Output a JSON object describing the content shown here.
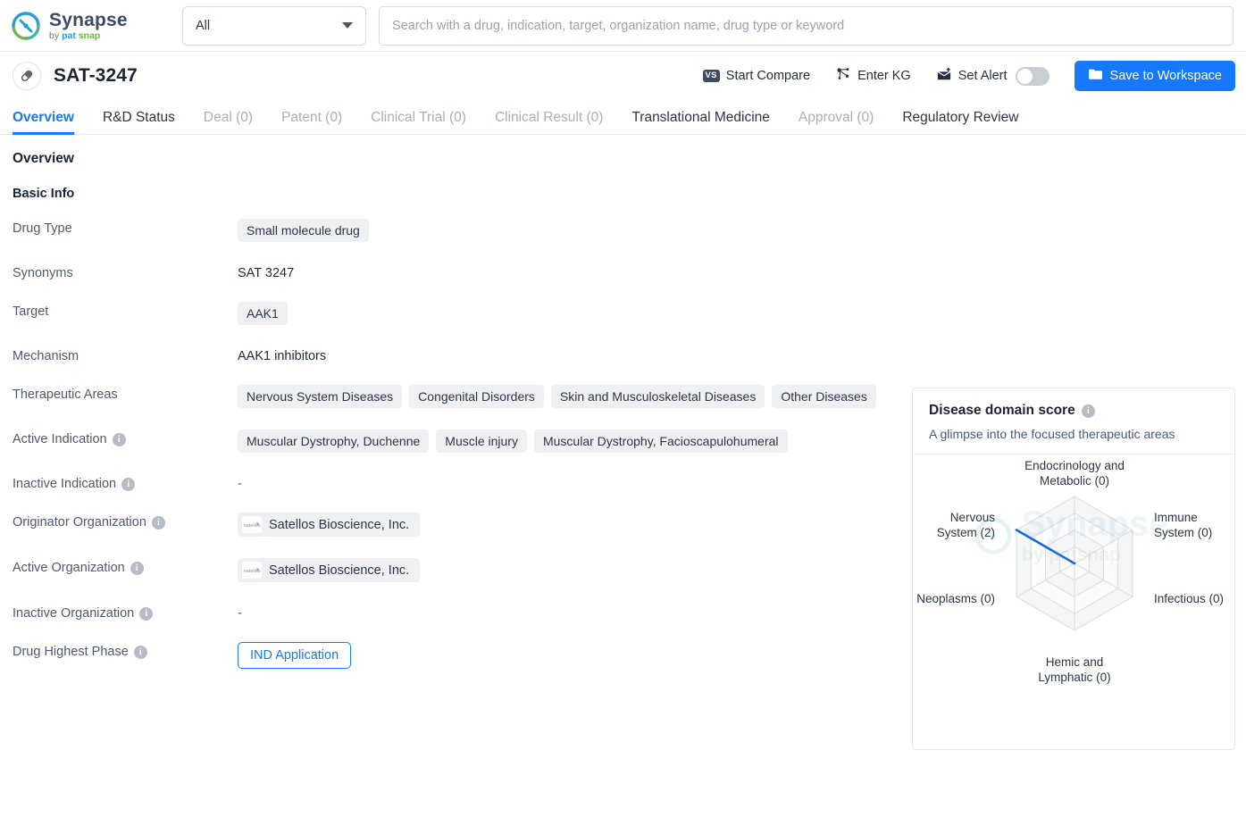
{
  "brand": {
    "name": "Synapse",
    "by": "by",
    "pat": "pat",
    "snap": "snap",
    "logo_icon": "synapse-logo-icon"
  },
  "search": {
    "scope_selected": "All",
    "scope_options": [
      "All"
    ],
    "placeholder": "Search with a drug, indication, target, organization name, drug type or keyword",
    "value": "",
    "dropdown_icon": "chevron-down-icon"
  },
  "drug_header": {
    "icon": "capsule-icon",
    "title": "SAT-3247",
    "actions": {
      "start_compare": "Start Compare",
      "start_compare_icon": "vs-icon",
      "enter_kg": "Enter KG",
      "enter_kg_icon": "knowledge-graph-icon",
      "set_alert": "Set Alert",
      "set_alert_icon": "alert-bell-icon",
      "alert_toggle_state": "off",
      "save_to_workspace": "Save to Workspace",
      "save_icon": "folder-icon"
    }
  },
  "tabs": [
    {
      "label": "Overview",
      "state": "active"
    },
    {
      "label": "R&D Status",
      "state": "enabled"
    },
    {
      "label": "Deal (0)",
      "state": "disabled"
    },
    {
      "label": "Patent (0)",
      "state": "disabled"
    },
    {
      "label": "Clinical Trial (0)",
      "state": "disabled"
    },
    {
      "label": "Clinical Result (0)",
      "state": "disabled"
    },
    {
      "label": "Translational Medicine",
      "state": "enabled"
    },
    {
      "label": "Approval (0)",
      "state": "disabled"
    },
    {
      "label": "Regulatory Review",
      "state": "enabled"
    }
  ],
  "overview": {
    "heading": "Overview",
    "basic_info_heading": "Basic Info",
    "rows": [
      {
        "label": "Drug Type",
        "has_info": false,
        "type": "tags",
        "values": [
          "Small molecule drug"
        ]
      },
      {
        "label": "Synonyms",
        "has_info": false,
        "type": "plain",
        "values": [
          "SAT 3247"
        ]
      },
      {
        "label": "Target",
        "has_info": false,
        "type": "tags",
        "values": [
          "AAK1"
        ]
      },
      {
        "label": "Mechanism",
        "has_info": false,
        "type": "plain",
        "values": [
          "AAK1 inhibitors"
        ]
      },
      {
        "label": "Therapeutic Areas",
        "has_info": false,
        "type": "tags",
        "values": [
          "Nervous System Diseases",
          "Congenital Disorders",
          "Skin and Musculoskeletal Diseases",
          "Other Diseases"
        ]
      },
      {
        "label": "Active Indication",
        "has_info": true,
        "type": "tags",
        "values": [
          "Muscular Dystrophy, Duchenne",
          "Muscle injury",
          "Muscular Dystrophy, Facioscapulohumeral"
        ]
      },
      {
        "label": "Inactive Indication",
        "has_info": true,
        "type": "empty",
        "values": [
          "-"
        ]
      },
      {
        "label": "Originator Organization",
        "has_info": true,
        "type": "org",
        "values": [
          "Satellos Bioscience, Inc."
        ]
      },
      {
        "label": "Active Organization",
        "has_info": true,
        "type": "org",
        "values": [
          "Satellos Bioscience, Inc."
        ]
      },
      {
        "label": "Inactive Organization",
        "has_info": true,
        "type": "empty",
        "values": [
          "-"
        ]
      },
      {
        "label": "Drug Highest Phase",
        "has_info": true,
        "type": "button",
        "values": [
          "IND Application"
        ]
      }
    ]
  },
  "radar_panel": {
    "title": "Disease domain score",
    "has_info": true,
    "subtitle": "A glimpse into the focused therapeutic areas"
  },
  "chart_data": {
    "type": "radar",
    "title": "Disease domain score",
    "subtitle": "A glimpse into the focused therapeutic areas",
    "categories": [
      "Endocrinology and Metabolic (0)",
      "Immune System (0)",
      "Infectious (0)",
      "Hemic and Lymphatic (0)",
      "Neoplasms (0)",
      "Nervous System (2)"
    ],
    "category_names": [
      "Endocrinology and Metabolic",
      "Immune System",
      "Infectious",
      "Hemic and Lymphatic",
      "Neoplasms",
      "Nervous System"
    ],
    "values": [
      0,
      0,
      0,
      0,
      0,
      2
    ],
    "rmax": 2,
    "rings": 4,
    "series_color": "#1668dc",
    "grid_color": "#d9dce1",
    "grid_fill": "#f3f4f6",
    "legend": "none"
  },
  "watermark": {
    "name": "Synapse",
    "sub": "by patsnap"
  },
  "colors": {
    "accent": "#1677ff",
    "tag_bg": "#eef0f4",
    "text": "#1f2a3d",
    "muted": "#4e5a70",
    "disabled": "#a8b0bd",
    "series_blue": "#1668dc"
  }
}
